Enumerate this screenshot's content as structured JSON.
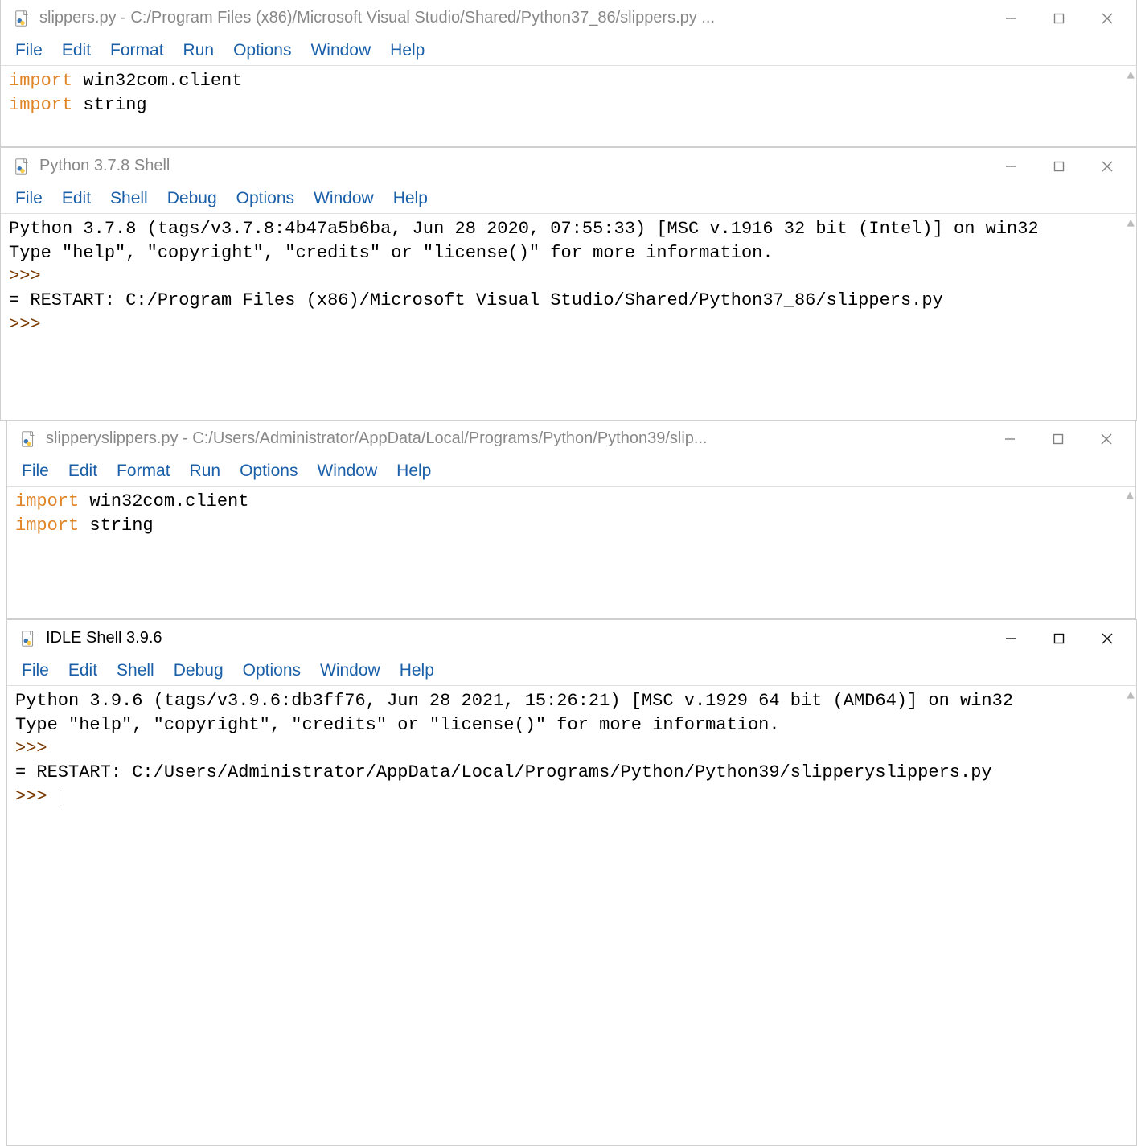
{
  "windows": [
    {
      "id": "editor1",
      "title": "slippers.py - C:/Program Files (x86)/Microsoft Visual Studio/Shared/Python37_86/slippers.py ...",
      "active": false,
      "menus": [
        "File",
        "Edit",
        "Format",
        "Run",
        "Options",
        "Window",
        "Help"
      ],
      "code": {
        "lines": [
          {
            "type": "import",
            "module": "win32com.client"
          },
          {
            "type": "import",
            "module": "string"
          }
        ]
      }
    },
    {
      "id": "shell1",
      "title": "Python 3.7.8 Shell",
      "active": false,
      "menus": [
        "File",
        "Edit",
        "Shell",
        "Debug",
        "Options",
        "Window",
        "Help"
      ],
      "shell": {
        "banner1": "Python 3.7.8 (tags/v3.7.8:4b47a5b6ba, Jun 28 2020, 07:55:33) [MSC v.1916 32 bit (Intel)] on win32",
        "banner2": "Type \"help\", \"copyright\", \"credits\" or \"license()\" for more information.",
        "prompt": ">>> ",
        "restart": "= RESTART: C:/Program Files (x86)/Microsoft Visual Studio/Shared/Python37_86/slippers.py",
        "trailing_prompt": ">>> "
      }
    },
    {
      "id": "editor2",
      "title": "slipperyslippers.py - C:/Users/Administrator/AppData/Local/Programs/Python/Python39/slip...",
      "active": false,
      "menus": [
        "File",
        "Edit",
        "Format",
        "Run",
        "Options",
        "Window",
        "Help"
      ],
      "code": {
        "lines": [
          {
            "type": "import",
            "module": "win32com.client"
          },
          {
            "type": "import",
            "module": "string"
          }
        ]
      }
    },
    {
      "id": "shell2",
      "title": "IDLE Shell 3.9.6",
      "active": true,
      "menus": [
        "File",
        "Edit",
        "Shell",
        "Debug",
        "Options",
        "Window",
        "Help"
      ],
      "shell": {
        "banner1": "Python 3.9.6 (tags/v3.9.6:db3ff76, Jun 28 2021, 15:26:21) [MSC v.1929 64 bit (AMD64)] on win32",
        "banner2": "Type \"help\", \"copyright\", \"credits\" or \"license()\" for more information.",
        "prompt": ">>> ",
        "restart": "= RESTART: C:/Users/Administrator/AppData/Local/Programs/Python/Python39/slipperyslippers.py",
        "trailing_prompt": ">>> "
      }
    }
  ]
}
